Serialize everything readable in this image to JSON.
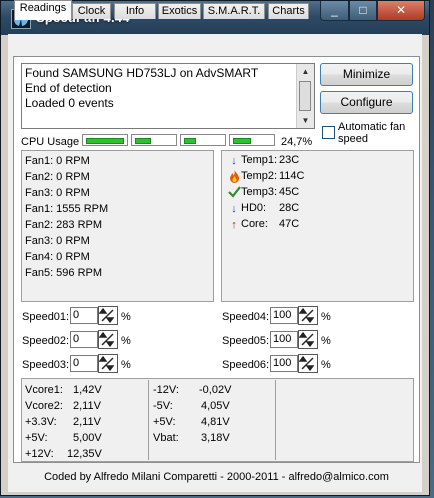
{
  "window": {
    "title": "SpeedFan 4.44",
    "controls": {
      "minimize": "_",
      "maximize": "□",
      "close": "✕"
    }
  },
  "tabs": [
    "Readings",
    "Clock",
    "Info",
    "Exotics",
    "S.M.A.R.T.",
    "Charts"
  ],
  "active_tab": "Readings",
  "log": {
    "lines": [
      "Found SAMSUNG HD753LJ on AdvSMART",
      "End of detection",
      "Loaded 0 events"
    ]
  },
  "buttons": {
    "minimize": "Minimize",
    "configure": "Configure"
  },
  "auto_fan": {
    "label_line1": "Automatic fan",
    "label_line2": "speed",
    "checked": false
  },
  "cpu": {
    "label": "CPU Usage",
    "percent": "24,7%",
    "bars_active": 4
  },
  "fans": [
    "Fan1: 0 RPM",
    "Fan2: 0 RPM",
    "Fan3: 0 RPM",
    "Fan1: 1555 RPM",
    "Fan2: 283 RPM",
    "Fan3: 0 RPM",
    "Fan4: 0 RPM",
    "Fan5: 596 RPM"
  ],
  "temps": [
    {
      "label": "Temp1:",
      "value": "23C",
      "icon": "arrow-down-icon",
      "color": "#1a3cc8"
    },
    {
      "label": "Temp2:",
      "value": "114C",
      "icon": "flame-icon",
      "color": "#e04a0c"
    },
    {
      "label": "Temp3:",
      "value": "45C",
      "icon": "checkmark-icon",
      "color": "#2e8b2e"
    },
    {
      "label": "HD0:",
      "value": "28C",
      "icon": "arrow-down-icon",
      "color": "#1a3cc8"
    },
    {
      "label": "Core:",
      "value": "47C",
      "icon": "arrow-up-icon",
      "color": "#d01818"
    }
  ],
  "speeds": [
    {
      "label": "Speed01:",
      "value": "0"
    },
    {
      "label": "Speed02:",
      "value": "0"
    },
    {
      "label": "Speed03:",
      "value": "0"
    },
    {
      "label": "Speed04:",
      "value": "100"
    },
    {
      "label": "Speed05:",
      "value": "100"
    },
    {
      "label": "Speed06:",
      "value": "100"
    }
  ],
  "percent_sign": "%",
  "voltages_left": [
    {
      "label": "Vcore1:",
      "value": "1,42V"
    },
    {
      "label": "Vcore2:",
      "value": "2,11V"
    },
    {
      "label": "+3.3V:",
      "value": "2,11V"
    },
    {
      "label": "+5V:",
      "value": "5,00V"
    },
    {
      "label": "+12V:",
      "value": "12,35V"
    }
  ],
  "voltages_right": [
    {
      "label": "-12V:",
      "value": "-0,02V"
    },
    {
      "label": "-5V:",
      "value": "4,05V"
    },
    {
      "label": "+5V:",
      "value": "4,81V"
    },
    {
      "label": "Vbat:",
      "value": "3,18V"
    }
  ],
  "footer": "Coded by Alfredo Milani Comparetti - 2000-2011 - alfredo@almico.com"
}
